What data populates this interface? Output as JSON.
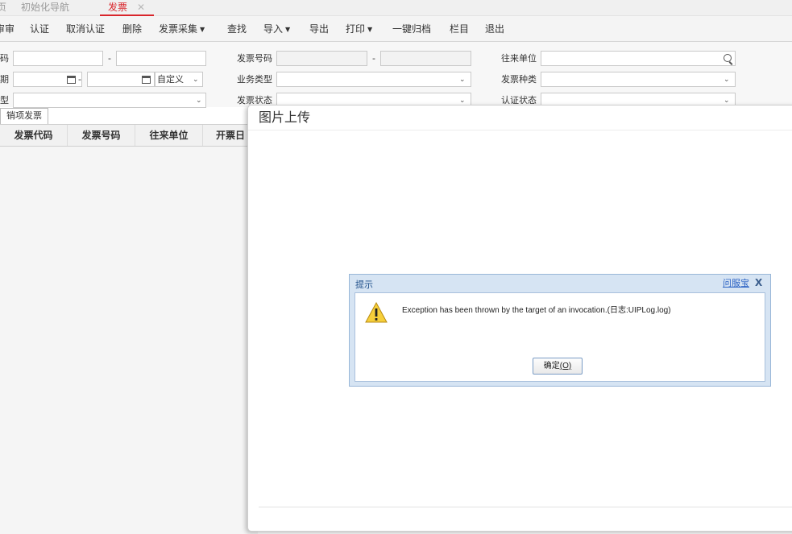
{
  "tabs": {
    "home_fragment": "页",
    "nav": "初始化导航",
    "invoice": "发票",
    "close": "✕"
  },
  "toolbar": {
    "review_fragment": "审审",
    "certify": "认证",
    "cancel_certify": "取消认证",
    "delete": "删除",
    "collect": "发票采集",
    "find": "查找",
    "import": "导入",
    "export": "导出",
    "print": "打印",
    "archive": "一键归档",
    "columns": "栏目",
    "exit": "退出"
  },
  "filters": {
    "code_label_fragment": "码",
    "date_label_fragment": "期",
    "type_label_fragment": "型",
    "date_range_mode": "自定义",
    "invoice_no_label": "发票号码",
    "business_type_label": "业务类型",
    "invoice_status_label": "发票状态",
    "partner_label": "往来单位",
    "invoice_kind_label": "发票种类",
    "certify_status_label": "认证状态",
    "dash": "-"
  },
  "subtab": {
    "label": "销项发票"
  },
  "table": {
    "columns": [
      "发票代码",
      "发票号码",
      "往来单位",
      "开票日"
    ]
  },
  "upload_panel": {
    "title": "图片上传"
  },
  "message_box": {
    "title": "提示",
    "help_link": "问服宝",
    "close": "X",
    "text": "Exception has been thrown by the target of an invocation.(日志:UIPLog.log)",
    "ok_label": "确定",
    "ok_accel": "(O)"
  }
}
